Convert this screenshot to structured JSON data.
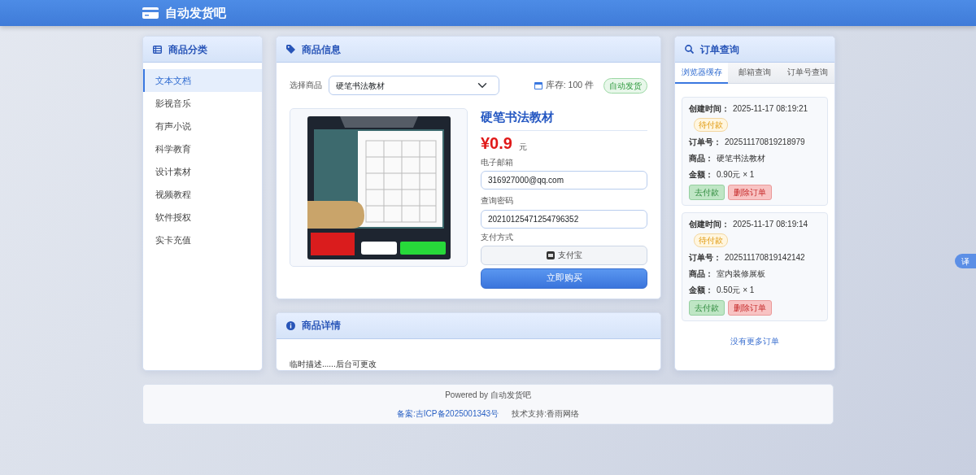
{
  "header": {
    "title": "自动发货吧"
  },
  "categories": {
    "title": "商品分类",
    "items": [
      {
        "label": "文本文档",
        "selected": true
      },
      {
        "label": "影视音乐",
        "selected": false
      },
      {
        "label": "有声小说",
        "selected": false
      },
      {
        "label": "科学教育",
        "selected": false
      },
      {
        "label": "设计素材",
        "selected": false
      },
      {
        "label": "视频教程",
        "selected": false
      },
      {
        "label": "软件授权",
        "selected": false
      },
      {
        "label": "实卡充值",
        "selected": false
      }
    ]
  },
  "product": {
    "title": "商品信息",
    "select_label": "选择商品",
    "selected_product": "硬笔书法教材",
    "stock": "库存: 100 件",
    "delivery_badge": "自动发货",
    "name": "硬笔书法教材",
    "price": "¥0.9",
    "unit": "元",
    "fields": [
      {
        "label": "电子邮箱",
        "value": "316927000@qq.com"
      },
      {
        "label": "查询密码",
        "value": "20210125471254796352"
      }
    ],
    "payment_label": "支付方式",
    "payment_method": "支付宝",
    "buy_button": "立即购买"
  },
  "details": {
    "title": "商品详情",
    "text": "临时描述......后台可更改"
  },
  "orders": {
    "title": "订单查询",
    "tabs": [
      {
        "label": "浏览器缓存",
        "selected": true
      },
      {
        "label": "邮箱查询",
        "selected": false
      },
      {
        "label": "订单号查询",
        "selected": false
      }
    ],
    "list": [
      {
        "created_label": "创建时间：",
        "created": "2025-11-17 08:19:21",
        "status": "待付款",
        "order_no_label": "订单号：",
        "order_no": "202511170819218979",
        "product_label": "商品：",
        "product": "硬笔书法教材",
        "amount_label": "金额：",
        "amount": "0.90元 × 1",
        "pay_button": "去付款",
        "delete_button": "删除订单"
      },
      {
        "created_label": "创建时间：",
        "created": "2025-11-17 08:19:14",
        "status": "待付款",
        "order_no_label": "订单号：",
        "order_no": "202511170819142142",
        "product_label": "商品：",
        "product": "室内装修展板",
        "amount_label": "金额：",
        "amount": "0.50元 × 1",
        "pay_button": "去付款",
        "delete_button": "删除订单"
      }
    ],
    "no_more": "没有更多订单"
  },
  "footer": {
    "powered": "Powered by 自动发货吧",
    "icp": "备案:吉ICP备2025001343号",
    "support": "技术支持:香雨网络"
  },
  "translate_button": "译"
}
